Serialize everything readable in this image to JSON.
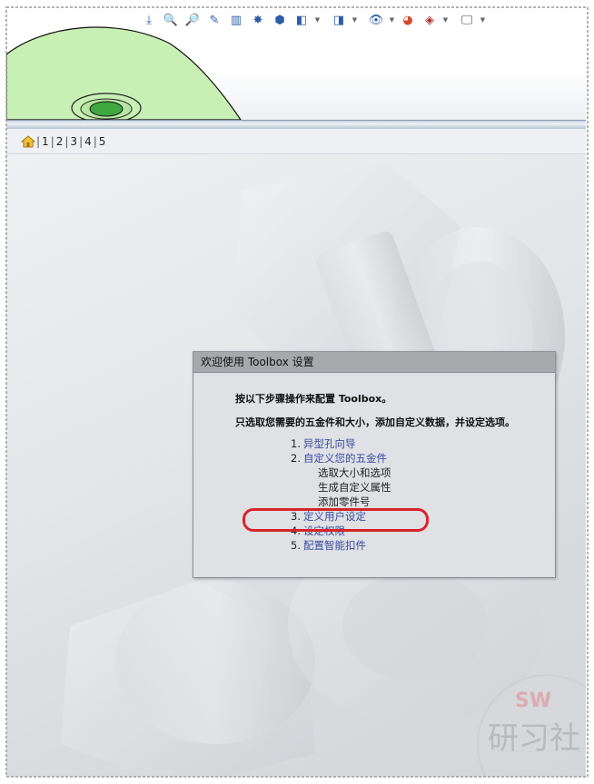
{
  "nav": {
    "separator": "|",
    "pages": [
      "1",
      "2",
      "3",
      "4",
      "5"
    ]
  },
  "dialog": {
    "title": "欢迎使用 Toolbox 设置",
    "intro_line1": "按以下步骤操作来配置 Toolbox。",
    "intro_line2": "只选取您需要的五金件和大小，添加自定义数据，并设定选项。",
    "steps": [
      {
        "num": "1.",
        "label": "异型孔向导"
      },
      {
        "num": "2.",
        "label": "自定义您的五金件",
        "subitems": [
          "选取大小和选项",
          "生成自定义属性",
          "添加零件号"
        ]
      },
      {
        "num": "3.",
        "label": "定义用户设定"
      },
      {
        "num": "4.",
        "label": "设定权限"
      },
      {
        "num": "5.",
        "label": "配置智能扣件"
      }
    ]
  },
  "watermark": {
    "brand": "SW",
    "text": "研习社"
  },
  "colors": {
    "link": "#3a4a9f",
    "highlight": "#d8232a",
    "part_fill": "#c8f0b4",
    "title_bar": "#a6a8ab"
  },
  "icons": [
    "fit-to-window-icon",
    "zoom-icon",
    "zoom-area-icon",
    "rotate-icon",
    "section-view-icon",
    "display-style-icon",
    "standard-views-icon",
    "hide-show-icon",
    "appearance-icon",
    "scene-icon",
    "monitor-icon"
  ]
}
